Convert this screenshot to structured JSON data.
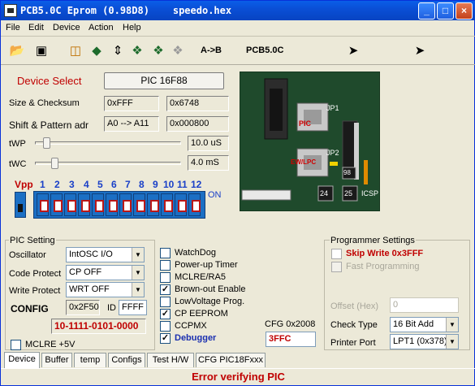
{
  "window": {
    "title": "PCB5.0C Eprom (0.98D8)    speedo.hex"
  },
  "menu": [
    "File",
    "Edit",
    "Device",
    "Action",
    "Help"
  ],
  "toolbar": {
    "ab_label": "A->B",
    "pcb_label": "PCB5.0C",
    "icons": [
      "open-folder-icon",
      "save-disk-icon",
      "erase-icon",
      "read-chip-icon",
      "program-icon",
      "verify-icon",
      "compare-icon",
      "auto-icon",
      "lock-icon",
      "lock2-icon"
    ]
  },
  "device": {
    "select_label": "Device Select",
    "chip_button": "PIC 16F88"
  },
  "size": {
    "label": "Size & Checksum",
    "size": "0xFFF",
    "checksum": "0x6748"
  },
  "shift": {
    "label": "Shift & Pattern adr",
    "range": "A0 --> A11",
    "addr": "0x000800"
  },
  "twp": {
    "label": "tWP",
    "value": "10.0 uS"
  },
  "twc": {
    "label": "tWC",
    "value": "4.0 mS"
  },
  "vpp": {
    "label": "Vpp",
    "numbers": [
      "1",
      "2",
      "3",
      "4",
      "5",
      "6",
      "7",
      "8",
      "9",
      "10",
      "11",
      "12"
    ],
    "on_label": "ON"
  },
  "board": {
    "jp1": "JP1",
    "jp2": "JP2",
    "pic_label": "PIC",
    "ewlpc_label": "EW/LPC",
    "icsp": "ICSP",
    "chip_24": "24",
    "chip_25": "25",
    "chip_98": "98"
  },
  "pic_setting": {
    "legend": "PIC Setting",
    "oscillator_label": "Oscillator",
    "oscillator": "IntOSC I/O",
    "code_protect_label": "Code Protect",
    "code_protect": "CP OFF",
    "write_protect_label": "Write Protect",
    "write_protect": "WRT OFF",
    "config_label": "CONFIG",
    "config_value": "0x2F50",
    "id_label": "ID",
    "id_value": "FFFF",
    "binary": "10-1111-0101-0000",
    "mclre5v": "MCLRE +5V"
  },
  "options": [
    {
      "label": "WatchDog",
      "checked": false
    },
    {
      "label": "Power-up Timer",
      "checked": false
    },
    {
      "label": "MCLRE/RA5",
      "checked": false
    },
    {
      "label": "Brown-out Enable",
      "checked": true
    },
    {
      "label": "LowVoltage Prog.",
      "checked": false
    },
    {
      "label": "CP  EEPROM",
      "checked": true
    },
    {
      "label": "CCPMX",
      "checked": false
    },
    {
      "label": "Debugger",
      "checked": true
    }
  ],
  "cfg": {
    "label": "CFG 0x2008",
    "value": "3FFC"
  },
  "programmer": {
    "legend": "Programmer Settings",
    "skip_write": "Skip Write 0x3FFF",
    "fast_prog": "Fast Programming",
    "offset_label": "Offset (Hex)",
    "offset": "0",
    "check_label": "Check Type",
    "check": "16 Bit Add",
    "port_label": "Printer Port",
    "port": "LPT1 (0x378)"
  },
  "tabs": [
    "Device",
    "Buffer",
    "temp",
    "Configs",
    "Test H/W",
    "CFG PIC18Fxxx"
  ],
  "status": "Error verifying PIC",
  "colors": {
    "title_blue": "#0a5ee8",
    "label_red": "#c00000",
    "dip_blue": "#1b6fc4"
  }
}
